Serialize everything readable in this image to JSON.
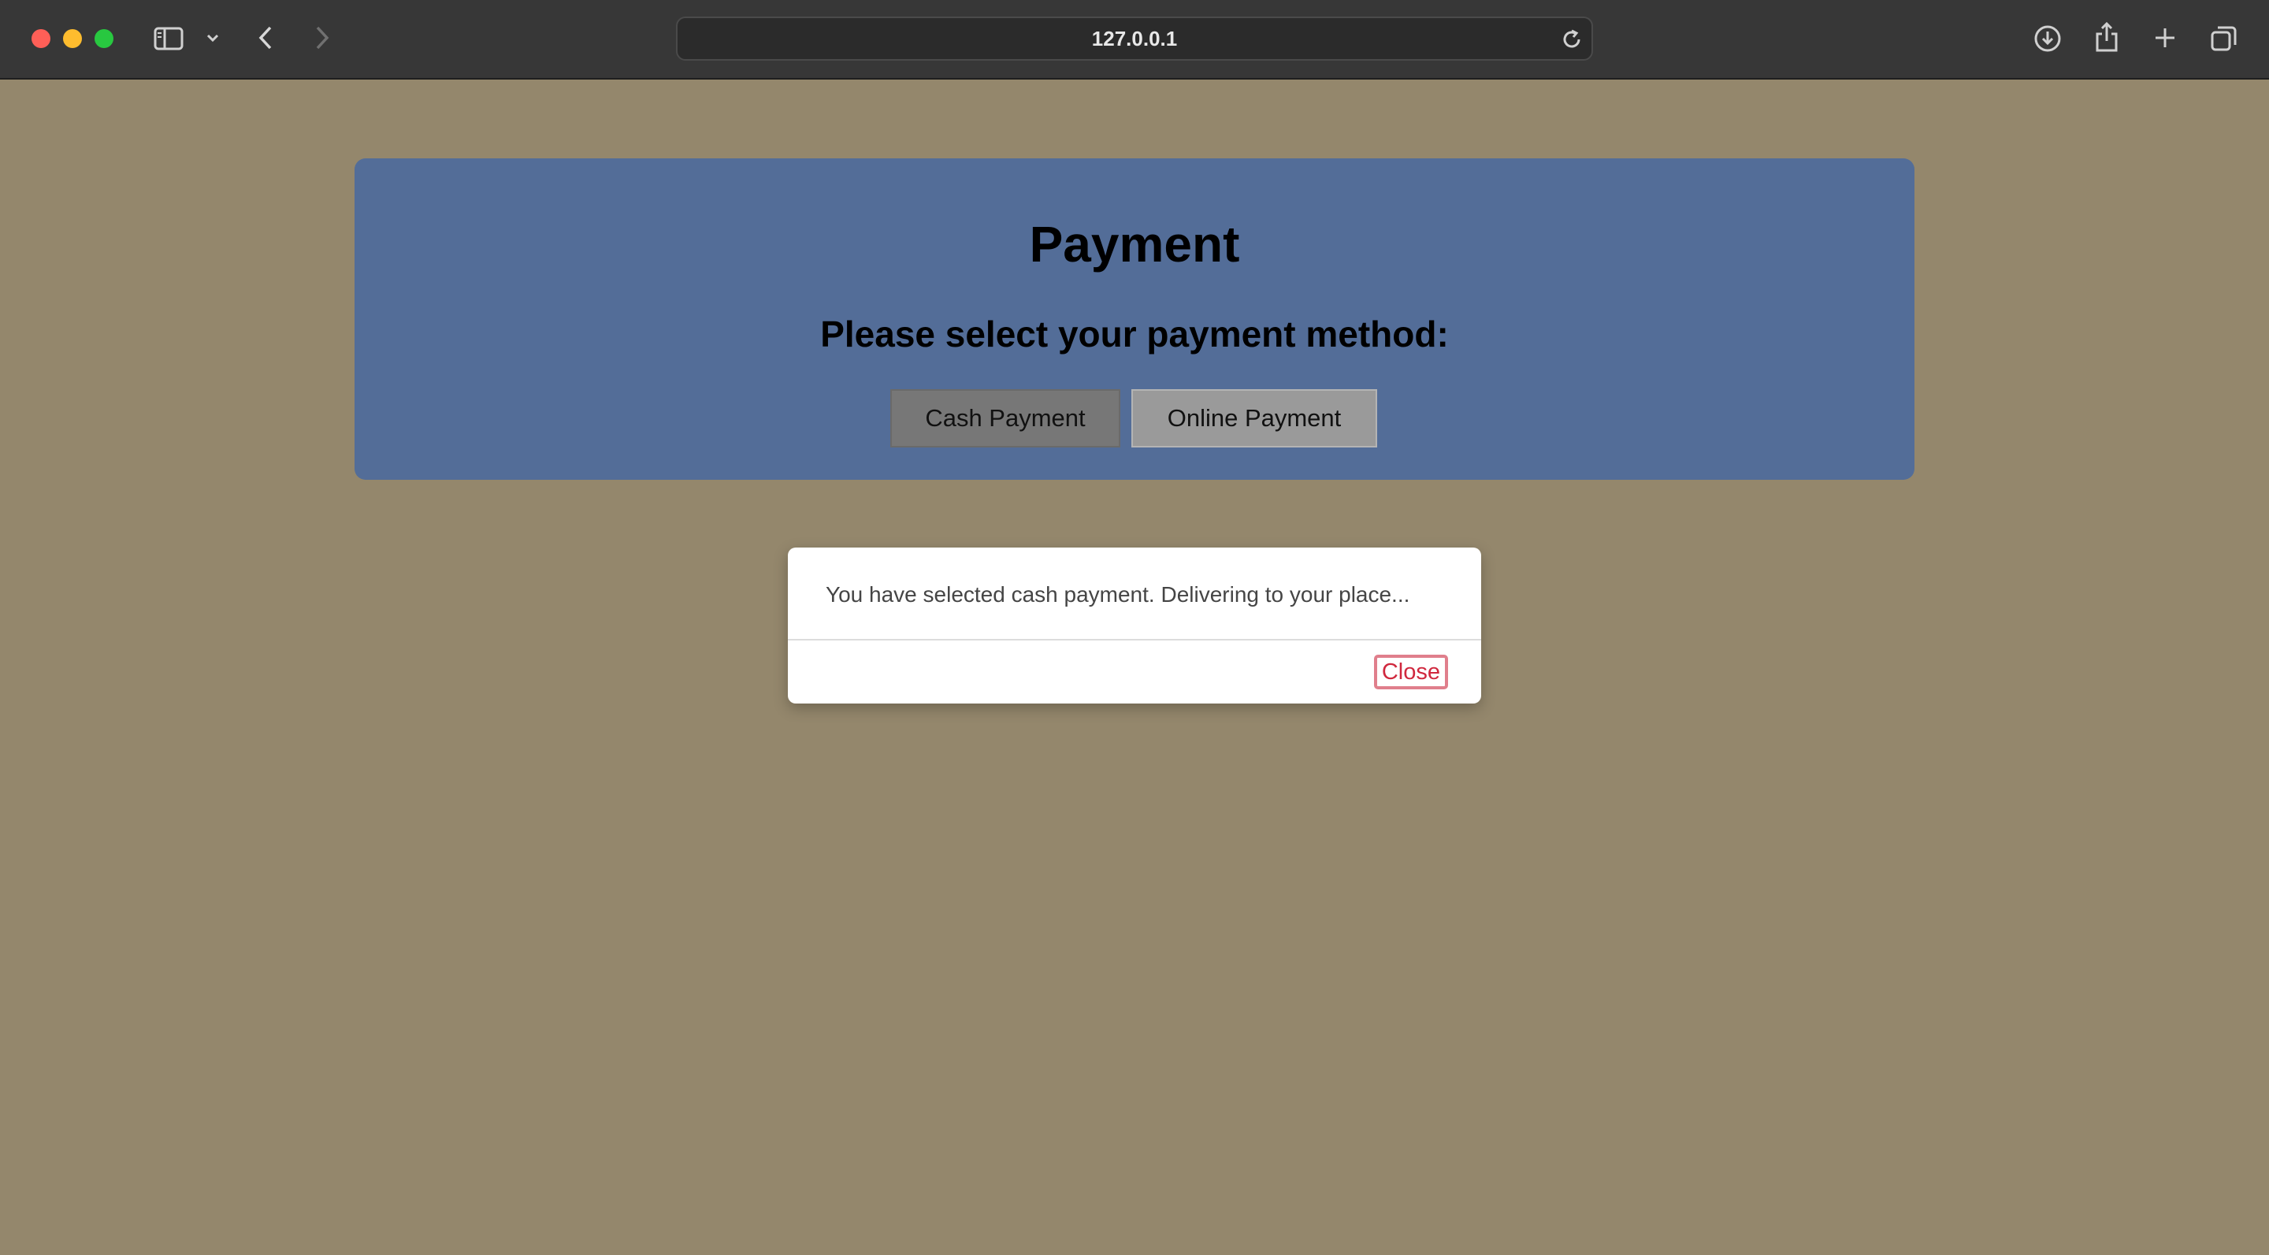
{
  "browser": {
    "address": "127.0.0.1",
    "icons": {
      "sidebar": "sidebar-icon",
      "sidebar_menu": "chevron-down-icon",
      "back": "chevron-left-icon",
      "forward": "chevron-right-icon",
      "reload": "reload-icon",
      "downloads": "download-icon",
      "share": "share-icon",
      "new_tab": "plus-icon",
      "tabs_overview": "tabs-icon"
    }
  },
  "page": {
    "title": "Payment",
    "subtitle": "Please select your payment method:",
    "buttons": {
      "cash": "Cash Payment",
      "online": "Online Payment"
    }
  },
  "modal": {
    "message": "You have selected cash payment. Delivering to your place...",
    "close_label": "Close"
  },
  "colors": {
    "page_background": "#94876c",
    "panel_background": "#536d98",
    "close_accent": "#d0283e"
  }
}
